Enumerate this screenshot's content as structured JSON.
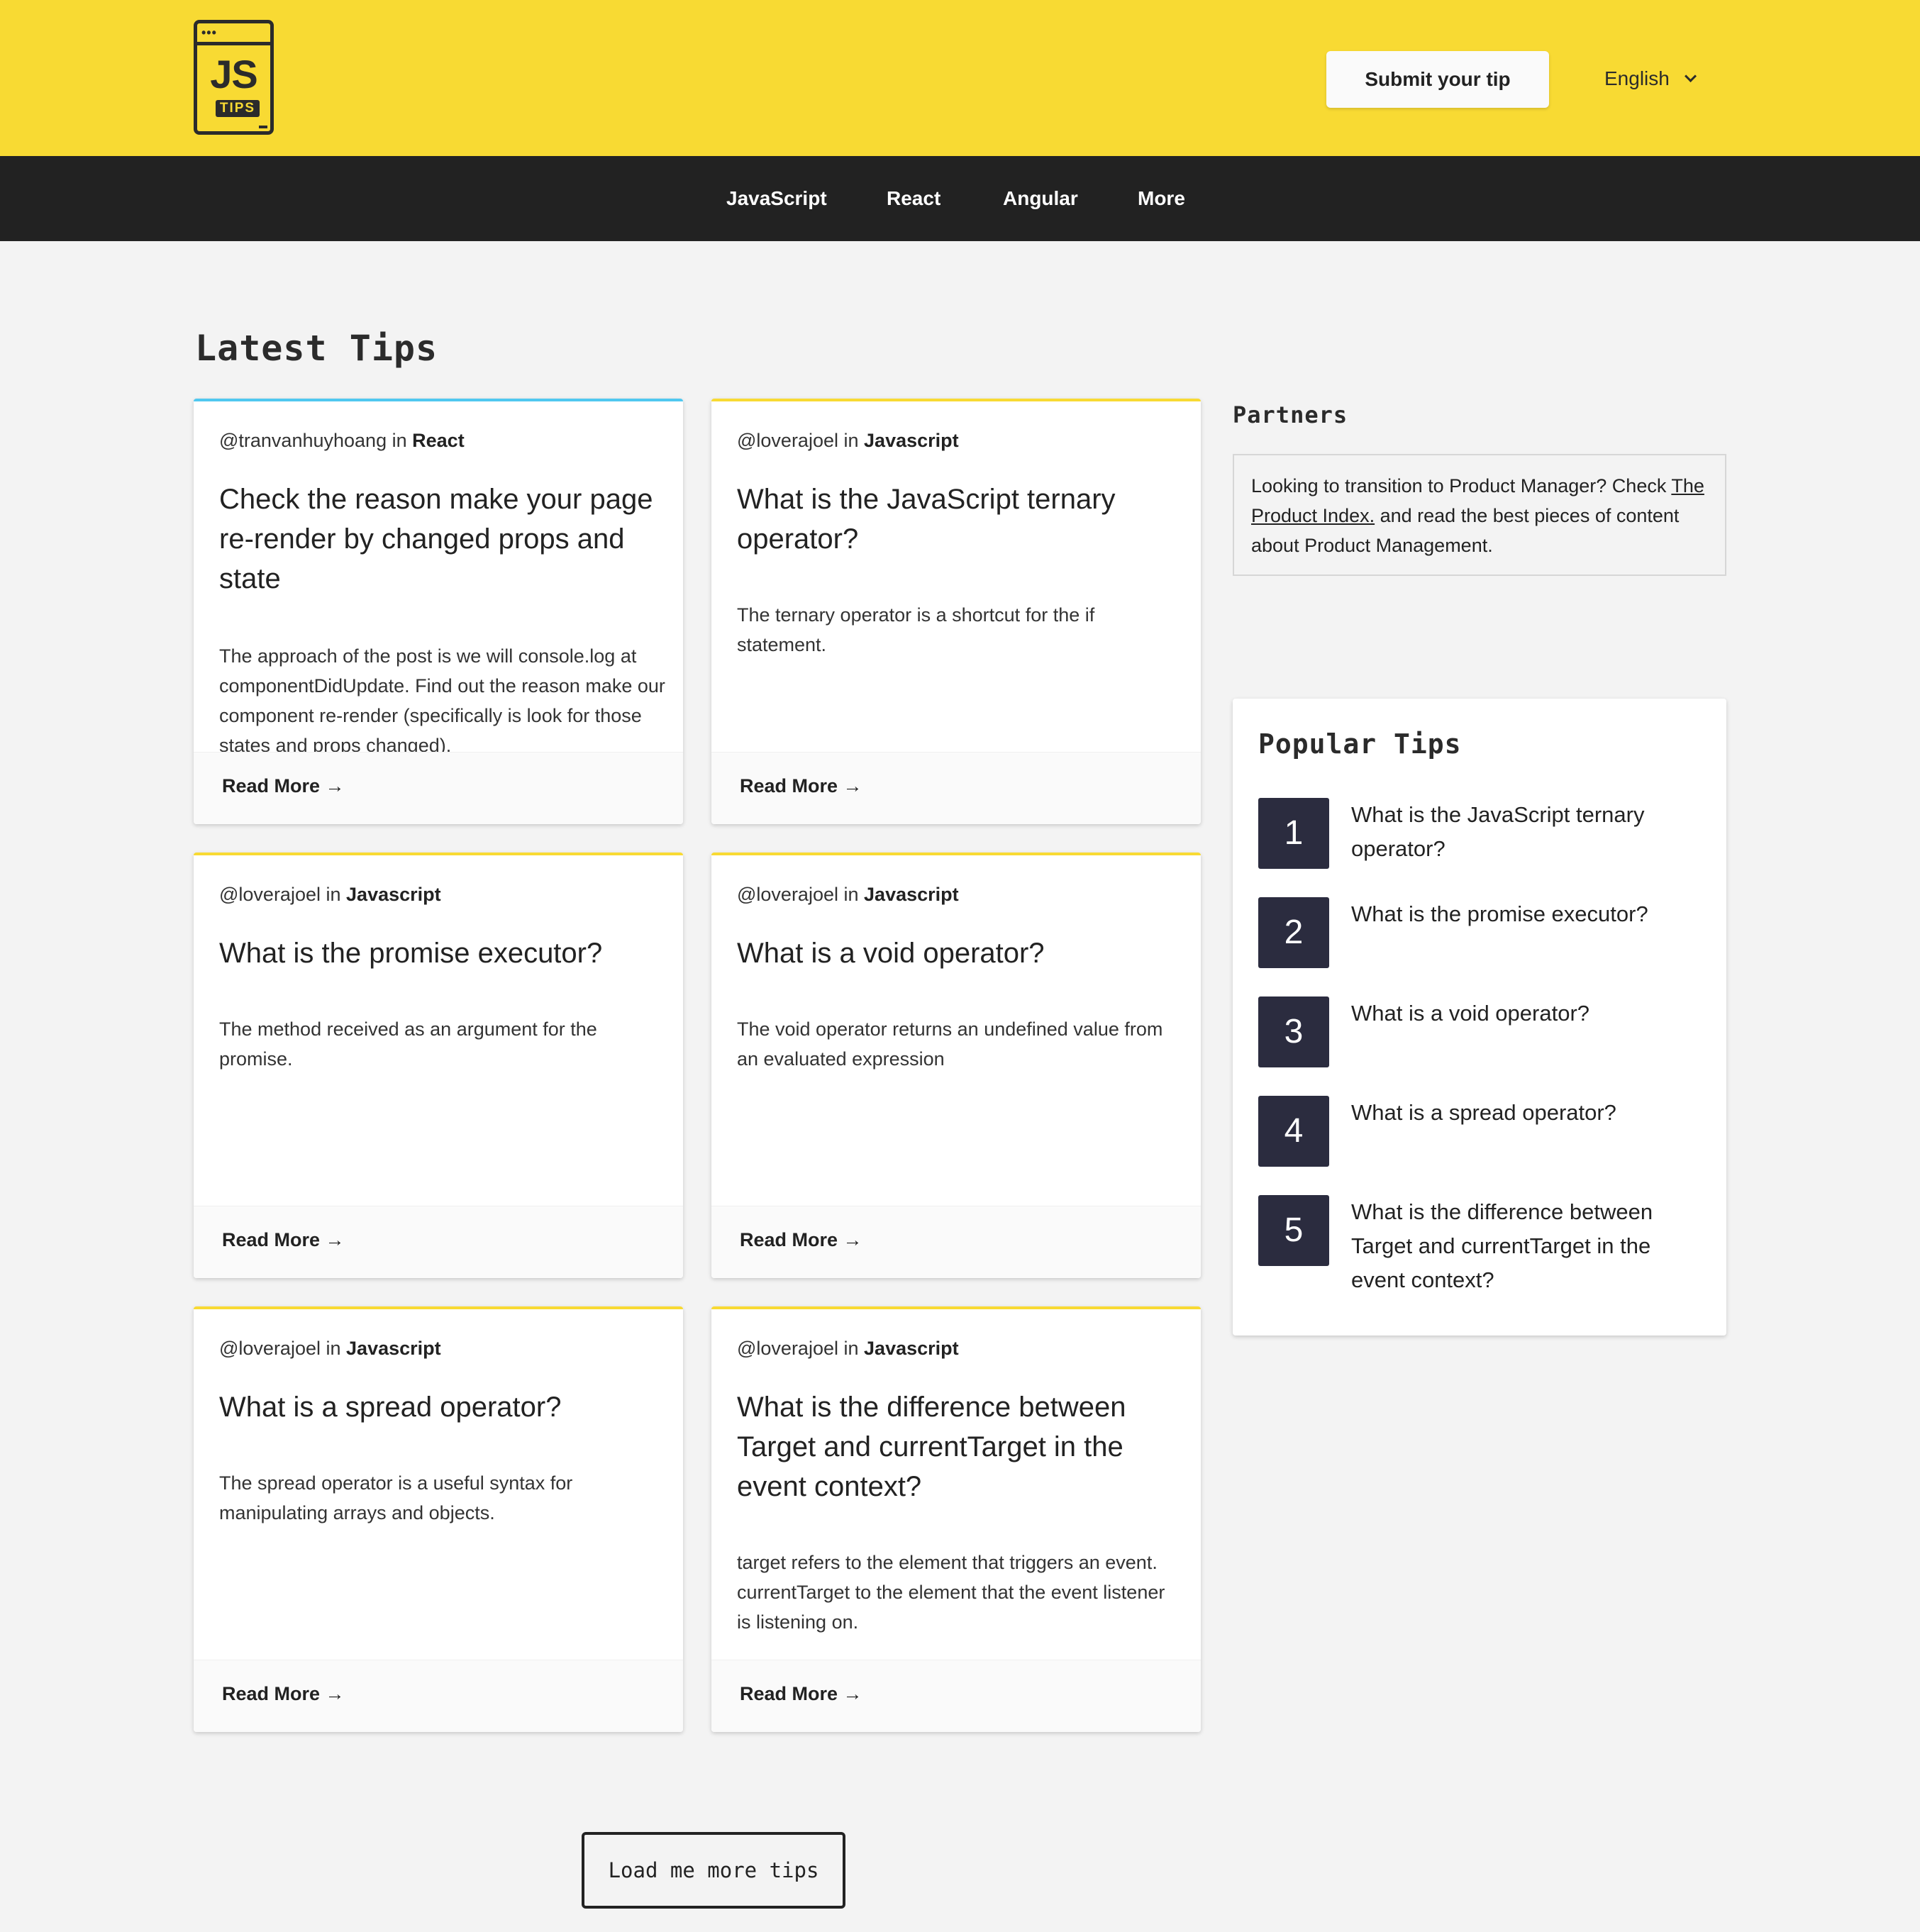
{
  "header": {
    "logo_main": "JS",
    "logo_sub": "TIPS",
    "submit_label": "Submit your tip",
    "language": "English"
  },
  "nav": [
    "JavaScript",
    "React",
    "Angular",
    "More"
  ],
  "main": {
    "title": "Latest Tips",
    "cards": [
      {
        "author": "@tranvanhuyhoang",
        "in": "in",
        "category": "React",
        "title": "Check the reason make your page re-render by changed props and state",
        "excerpt": "The approach of the post is we will console.log at componentDidUpdate. Find out the reason make our component re-render (specifically is look for those states and props changed).",
        "read_more": "Read More →"
      },
      {
        "author": "@loverajoel",
        "in": "in",
        "category": "Javascript",
        "title": "What is the JavaScript ternary operator?",
        "excerpt": "The ternary operator is a shortcut for the if statement.",
        "read_more": "Read More →"
      },
      {
        "author": "@loverajoel",
        "in": "in",
        "category": "Javascript",
        "title": "What is the promise executor?",
        "excerpt": "The method received as an argument for the promise.",
        "read_more": "Read More →"
      },
      {
        "author": "@loverajoel",
        "in": "in",
        "category": "Javascript",
        "title": "What is a void operator?",
        "excerpt": "The void operator returns an undefined value from an evaluated expression",
        "read_more": "Read More →"
      },
      {
        "author": "@loverajoel",
        "in": "in",
        "category": "Javascript",
        "title": "What is a spread operator?",
        "excerpt": "The spread operator is a useful syntax for manipulating arrays and objects.",
        "read_more": "Read More →"
      },
      {
        "author": "@loverajoel",
        "in": "in",
        "category": "Javascript",
        "title": "What is the difference between Target and currentTarget in the event context?",
        "excerpt": "target refers to the element that triggers an event. currentTarget to the element that the event listener is listening on.",
        "read_more": "Read More →"
      }
    ],
    "load_more": "Load me more tips"
  },
  "sidebar": {
    "partners_title": "Partners",
    "partners_text_before": "Looking to transition to Product Manager? Check ",
    "partners_link": "The Product Index.",
    "partners_text_after": " and read the best pieces of content about Product Management.",
    "popular_title": "Popular Tips",
    "popular": [
      {
        "num": "1",
        "title": "What is the JavaScript ternary operator?"
      },
      {
        "num": "2",
        "title": "What is the promise executor?"
      },
      {
        "num": "3",
        "title": "What is a void operator?"
      },
      {
        "num": "4",
        "title": "What is a spread operator?"
      },
      {
        "num": "5",
        "title": "What is the difference between Target and currentTarget in the event context?"
      }
    ]
  },
  "colors": {
    "brand_yellow": "#f8da33",
    "nav_dark": "#222222",
    "react_blue": "#50c8f0",
    "number_badge": "#2b2c3f"
  }
}
